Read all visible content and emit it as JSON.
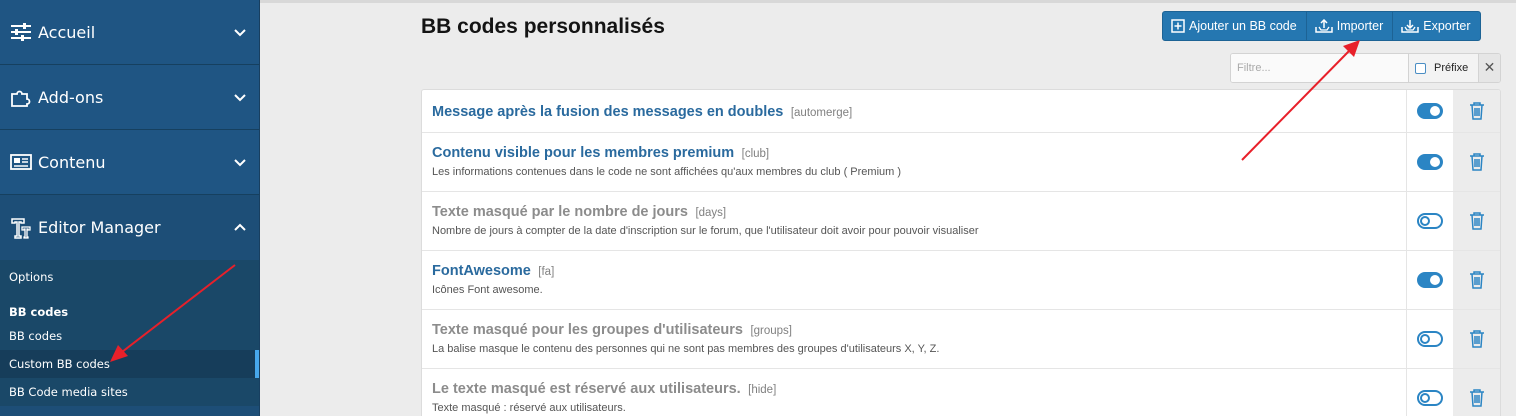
{
  "sidebar": {
    "sections": [
      {
        "label": "Accueil",
        "icon": "sliders-icon",
        "expanded": false
      },
      {
        "label": "Add-ons",
        "icon": "puzzle-icon",
        "expanded": false
      },
      {
        "label": "Contenu",
        "icon": "newspaper-icon",
        "expanded": false
      },
      {
        "label": "Editor Manager",
        "icon": "text-tool-icon",
        "expanded": true
      }
    ],
    "submenu": {
      "options_label": "Options",
      "group_heading": "BB codes",
      "bbcodes_label": "BB codes",
      "custom_label": "Custom BB codes",
      "media_label": "BB Code media sites"
    }
  },
  "header": {
    "title": "BB codes personnalisés",
    "buttons": {
      "add": "Ajouter un BB code",
      "import": "Importer",
      "export": "Exporter"
    }
  },
  "filter": {
    "placeholder": "Filtre...",
    "prefix_label": "Préfixe",
    "clear_symbol": "✕"
  },
  "rows": [
    {
      "title": "Message après la fusion des messages en doubles",
      "key": "[automerge]",
      "desc": "",
      "enabled": true
    },
    {
      "title": "Contenu visible pour les membres premium",
      "key": "[club]",
      "desc": "Les informations contenues dans le code ne sont affichées qu'aux membres du club ( Premium )",
      "enabled": true
    },
    {
      "title": "Texte masqué par le nombre de jours",
      "key": "[days]",
      "desc": "Nombre de jours à compter de la date d'inscription sur le forum, que l'utilisateur doit avoir pour pouvoir visualiser",
      "enabled": false
    },
    {
      "title": "FontAwesome",
      "key": "[fa]",
      "desc": "Icônes Font awesome.",
      "enabled": true
    },
    {
      "title": "Texte masqué pour les groupes d'utilisateurs",
      "key": "[groups]",
      "desc": "La balise masque le contenu des personnes qui ne sont pas membres des groupes d'utilisateurs X, Y, Z.",
      "enabled": false
    },
    {
      "title": "Le texte masqué est réservé aux utilisateurs.",
      "key": "[hide]",
      "desc": "Texte masqué : réservé aux utilisateurs.",
      "enabled": false
    }
  ],
  "colors": {
    "sidebar_bg": "#1d4e77",
    "accent": "#2577b1",
    "link": "#2a6a9e",
    "annotation_arrow": "#e8202a"
  }
}
